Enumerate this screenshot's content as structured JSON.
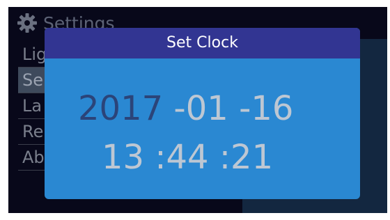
{
  "settings": {
    "title": "Settings",
    "items": [
      {
        "label": "Lig"
      },
      {
        "label": "Se"
      },
      {
        "label": "La"
      },
      {
        "label": "Re"
      },
      {
        "label": "Ab"
      }
    ],
    "selected_index": 1
  },
  "dialog": {
    "title": "Set Clock",
    "year": "2017",
    "date_sep_1": " -",
    "month": "01",
    "date_sep_2": " -",
    "day": "16",
    "hour": "13",
    "time_sep_1": " :",
    "minute": "44",
    "time_sep_2": " :",
    "second": "21",
    "focused_field": "year"
  },
  "colors": {
    "dialog_bg": "#2a88d2",
    "title_bar": "#323592",
    "focused_text": "#2b4479",
    "unfocused_text": "#bdc7d3",
    "screen_bg": "#08081a"
  },
  "icons": {
    "settings": "gear-icon"
  }
}
